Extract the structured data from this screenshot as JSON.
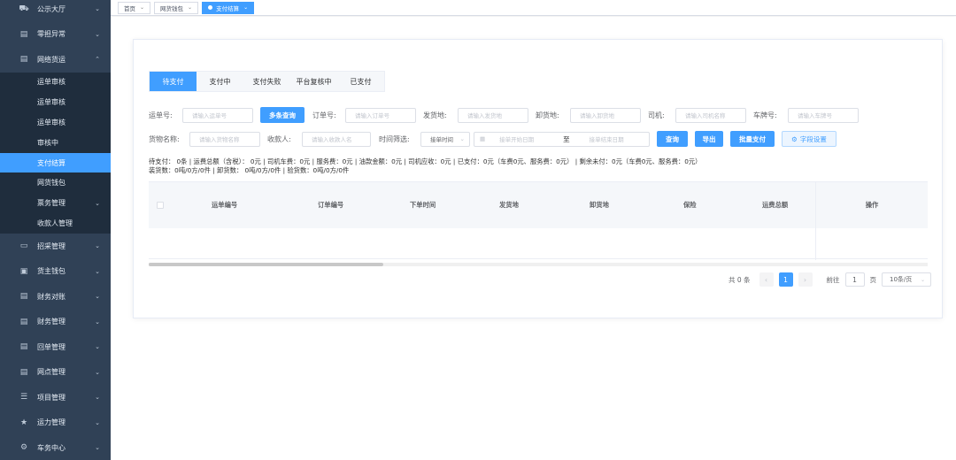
{
  "sidebar": {
    "items": [
      {
        "label": "公示大厅",
        "icon": "truck-icon"
      },
      {
        "label": "零担异常",
        "icon": "document-icon"
      },
      {
        "label": "网络货运",
        "icon": "document-icon",
        "expanded": true
      },
      {
        "label": "招采管理",
        "icon": "monitor-icon"
      },
      {
        "label": "货主钱包",
        "icon": "wallet-icon"
      },
      {
        "label": "财务对账",
        "icon": "document-icon"
      },
      {
        "label": "财务管理",
        "icon": "document-icon"
      },
      {
        "label": "回单管理",
        "icon": "document-icon"
      },
      {
        "label": "网点管理",
        "icon": "document-icon"
      },
      {
        "label": "项目管理",
        "icon": "list-icon"
      },
      {
        "label": "运力管理",
        "icon": "star-icon"
      },
      {
        "label": "车务中心",
        "icon": "gear-icon"
      }
    ],
    "subitems": [
      {
        "label": "运单审核"
      },
      {
        "label": "运单审核"
      },
      {
        "label": "运单审核"
      },
      {
        "label": "审核中"
      },
      {
        "label": "支付结算",
        "active": true
      },
      {
        "label": "网货钱包"
      },
      {
        "label": "票务管理",
        "has_children": true
      },
      {
        "label": "收款人管理"
      }
    ]
  },
  "tags": [
    {
      "label": "首页"
    },
    {
      "label": "网货钱包"
    },
    {
      "label": "支付结算",
      "active": true
    }
  ],
  "tabs": [
    {
      "label": "待支付",
      "active": true
    },
    {
      "label": "支付中"
    },
    {
      "label": "支付失败"
    },
    {
      "label": "平台复核中"
    },
    {
      "label": "已支付"
    }
  ],
  "filters": {
    "waybill_label": "运单号:",
    "waybill_placeholder": "请输入运单号",
    "multi_query": "多条查询",
    "order_label": "订单号:",
    "order_placeholder": "请输入订单号",
    "origin_label": "发货地:",
    "origin_placeholder": "请输入发货地",
    "dest_label": "卸货地:",
    "dest_placeholder": "请输入卸货地",
    "driver_label": "司机:",
    "driver_placeholder": "请输入司机名称",
    "plate_label": "车牌号:",
    "plate_placeholder": "请输入车牌号",
    "goods_label": "货物名称:",
    "goods_placeholder": "请输入货物名称",
    "payee_label": "收款人:",
    "payee_placeholder": "请输入收款人名",
    "time_label": "时间筛选:",
    "time_select": "接单时间",
    "start_date": "接单开始日期",
    "to": "至",
    "end_date": "接单结束日期",
    "query": "查询",
    "export": "导出",
    "batch_pay": "批量支付",
    "field_settings": "字段设置"
  },
  "summary": {
    "line1": "待支付： 0条 | 运费总额（含税）： 0元 | 司机车费：0元 | 服务费：0元 | 油款金额：0元 | 司机应收：0元 | 已支付：0元（车费0元、服务费：0元） | 剩余未付：0元（车费0元、服务费：0元）",
    "line2": "装货数：0吨/0方/0件 | 卸货数： 0吨/0方/0件 | 验货数：0吨/0方/0件"
  },
  "table": {
    "columns": [
      "运单编号",
      "订单编号",
      "下单时间",
      "发货地",
      "卸货地",
      "保险",
      "运费总额"
    ],
    "action_column": "操作",
    "rows": []
  },
  "pagination": {
    "total": "共 0 条",
    "current_page": "1",
    "goto_label": "前往",
    "goto_value": "1",
    "page_unit": "页",
    "page_size": "10条/页"
  },
  "colors": {
    "sidebar_bg": "#304156",
    "accent": "#409eff"
  }
}
